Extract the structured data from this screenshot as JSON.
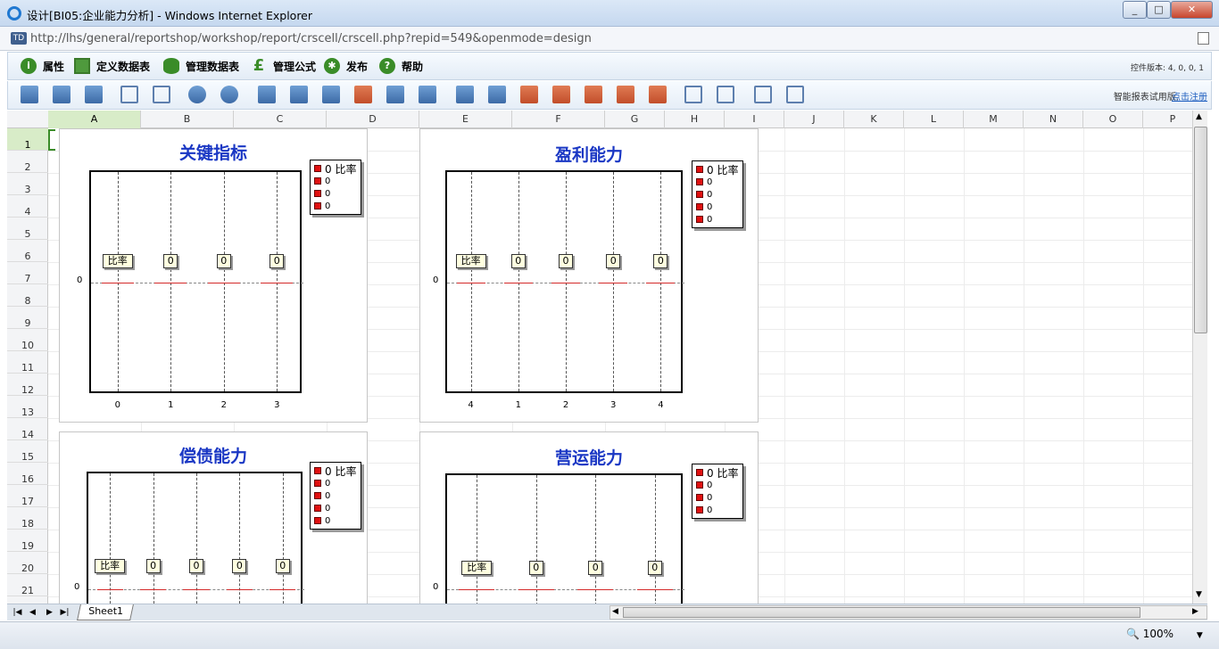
{
  "window": {
    "title": "设计[BI05:企业能力分析] - Windows Internet Explorer",
    "min": "_",
    "max": "□",
    "close": "✕"
  },
  "address": {
    "url": "http://lhs/general/reportshop/workshop/report/crscell/crscell.php?repid=549&openmode=design",
    "icon_text": "TD"
  },
  "menu": [
    {
      "label": "属性",
      "icon": "info-icon"
    },
    {
      "label": "定义数据表",
      "icon": "table-define-icon"
    },
    {
      "label": "管理数据表",
      "icon": "database-icon"
    },
    {
      "label": "管理公式",
      "icon": "pound-formula-icon"
    },
    {
      "label": "发布",
      "icon": "gear-publish-icon"
    },
    {
      "label": "帮助",
      "icon": "help-icon"
    }
  ],
  "version_text": "控件版本: 4, 0, 0, 1",
  "trial_note": "智能报表试用版,",
  "register_link": "点击注册",
  "columns": [
    "A",
    "B",
    "C",
    "D",
    "E",
    "F",
    "G",
    "H",
    "I",
    "J",
    "K",
    "L",
    "M",
    "N",
    "O",
    "P"
  ],
  "rows": [
    "1",
    "2",
    "3",
    "4",
    "5",
    "6",
    "7",
    "8",
    "9",
    "10",
    "11",
    "12",
    "13",
    "14",
    "15",
    "16",
    "17",
    "18",
    "19",
    "20",
    "21"
  ],
  "sheet_tab": "Sheet1",
  "zoom": "100%",
  "colors": {
    "title": "#1a37c4",
    "series": "#e01010",
    "accent": "#3a8c28"
  },
  "chart_data": [
    {
      "type": "bar",
      "title": "关键指标",
      "categories": [
        "0",
        "1",
        "2",
        "3"
      ],
      "labels": [
        "比率",
        "0",
        "0",
        "0"
      ],
      "values": [
        0,
        0,
        0,
        0
      ],
      "y_ticks": [
        "0"
      ],
      "legend": [
        "0 比率",
        "0",
        "0",
        "0"
      ]
    },
    {
      "type": "bar",
      "title": "盈利能力",
      "categories": [
        "4",
        "1",
        "2",
        "3",
        "4"
      ],
      "labels": [
        "比率",
        "0",
        "0",
        "0",
        "0"
      ],
      "values": [
        0,
        0,
        0,
        0,
        0
      ],
      "y_ticks": [
        "0"
      ],
      "legend": [
        "0 比率",
        "0",
        "0",
        "0",
        "0"
      ]
    },
    {
      "type": "bar",
      "title": "偿债能力",
      "categories": [],
      "labels": [
        "比率",
        "0",
        "0",
        "0",
        "0"
      ],
      "values": [
        0,
        0,
        0,
        0,
        0
      ],
      "y_ticks": [
        "0"
      ],
      "legend": [
        "0 比率",
        "0",
        "0",
        "0",
        "0"
      ]
    },
    {
      "type": "bar",
      "title": "营运能力",
      "categories": [],
      "labels": [
        "比率",
        "0",
        "0",
        "0"
      ],
      "values": [
        0,
        0,
        0,
        0
      ],
      "y_ticks": [
        "0"
      ],
      "legend": [
        "0 比率",
        "0",
        "0",
        "0"
      ]
    }
  ]
}
